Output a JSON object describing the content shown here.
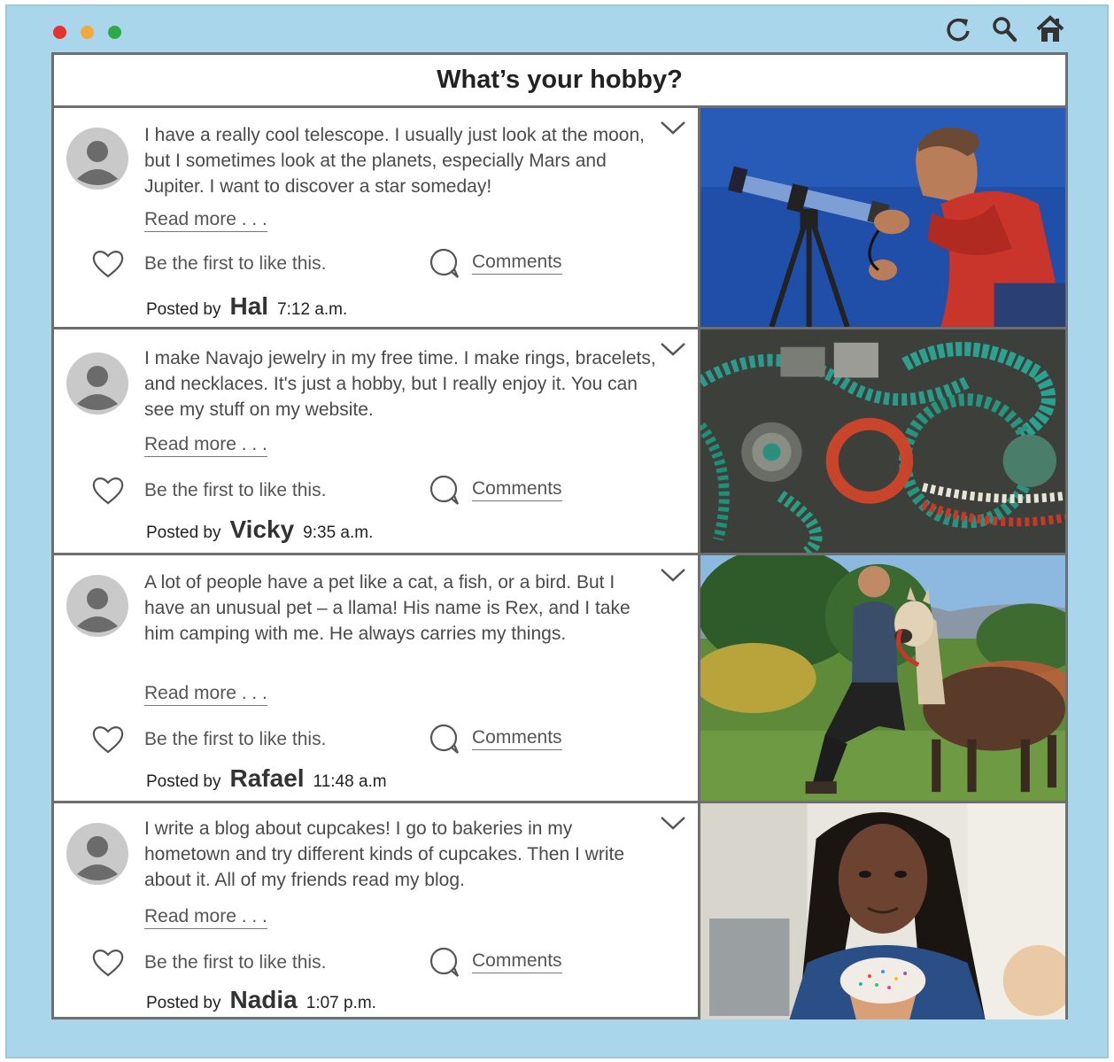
{
  "window": {
    "traffic_lights": [
      "#e6322e",
      "#f2a93b",
      "#2fa84a"
    ],
    "toolbar_icons": [
      "refresh-icon",
      "search-icon",
      "home-icon"
    ]
  },
  "page": {
    "title": "What’s your hobby?"
  },
  "posts": [
    {
      "text": "I have a really cool telescope. I usually just look at the moon, but I sometimes look at the planets, especially Mars and Jupiter. I want to discover a star someday!",
      "read_more": "Read more . . .",
      "like_text": "Be the first to like this.",
      "comments_label": "Comments",
      "posted_by_label": "Posted by",
      "author": "Hal",
      "time": "7:12 a.m.",
      "photo": "man-with-telescope"
    },
    {
      "text": "I make Navajo jewelry in my free time. I make rings, bracelets, and necklaces. It's just a hobby, but I really enjoy it. You can see my stuff on my website.",
      "read_more": "Read more . . .",
      "like_text": "Be the first to like this.",
      "comments_label": "Comments",
      "posted_by_label": "Posted by",
      "author": "Vicky",
      "time": "9:35 a.m.",
      "photo": "turquoise-jewelry"
    },
    {
      "text": "A lot of people have a pet like a cat, a fish, or a bird. But I have an unusual pet – a llama! His name is Rex, and I take him camping with me. He always carries my things.",
      "read_more": "Read more . . .",
      "like_text": "Be the first to like this.",
      "comments_label": "Comments",
      "posted_by_label": "Posted by",
      "author": "Rafael",
      "time": "11:48 a.m",
      "photo": "man-with-llama"
    },
    {
      "text": "I write a blog about cupcakes! I go to bakeries in my hometown and try different kinds of cupcakes. Then I write about it. All of my friends read my blog.",
      "read_more": "Read more . . .",
      "like_text": "Be the first to like this.",
      "comments_label": "Comments",
      "posted_by_label": "Posted by",
      "author": "Nadia",
      "time": "1:07 p.m.",
      "photo": "woman-with-cupcake"
    }
  ]
}
